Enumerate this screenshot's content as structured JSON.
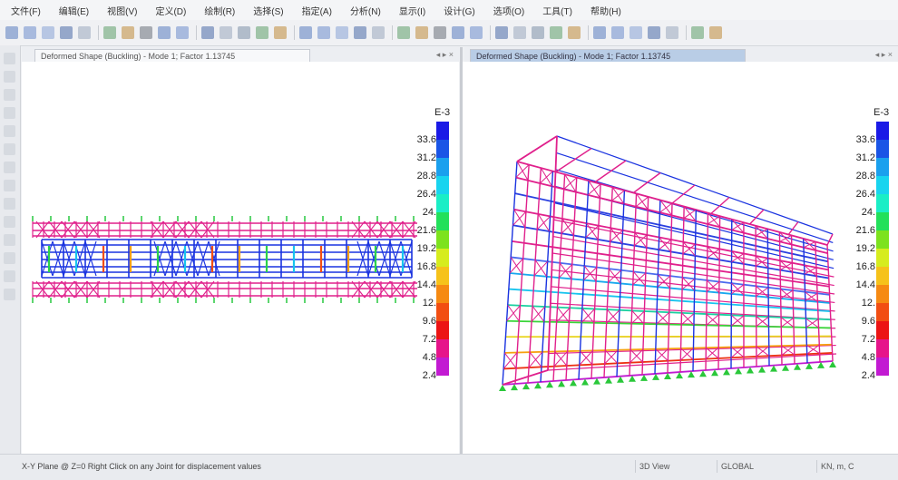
{
  "menu": [
    "文件(F)",
    "编辑(E)",
    "视图(V)",
    "定义(D)",
    "绘制(R)",
    "选择(S)",
    "指定(A)",
    "分析(N)",
    "显示(I)",
    "设计(G)",
    "选项(O)",
    "工具(T)",
    "帮助(H)"
  ],
  "left_view": {
    "tab_title": "Deformed Shape (Buckling) - Mode 1; Factor 1.13745",
    "tab_controls": "◂ ▸ ×",
    "legend": {
      "exponent": "E-3",
      "labels": [
        "33.6",
        "31.2",
        "28.8",
        "26.4",
        "24.",
        "21.6",
        "19.2",
        "16.8",
        "14.4",
        "12.",
        "9.6",
        "7.2",
        "4.8",
        "2.4"
      ]
    }
  },
  "right_view": {
    "tab_title": "Deformed Shape (Buckling) - Mode 1; Factor 1.13745",
    "tab_controls": "◂ ▸ ×",
    "legend": {
      "exponent": "E-3",
      "labels": [
        "33.6",
        "31.2",
        "28.8",
        "26.4",
        "24.",
        "21.6",
        "19.2",
        "16.8",
        "14.4",
        "12.",
        "9.6",
        "7.2",
        "4.8",
        "2.4"
      ]
    }
  },
  "legend_colors": [
    "#1a1ae6",
    "#1a55e6",
    "#1aa0ee",
    "#18d4ef",
    "#1aeec6",
    "#22e05a",
    "#7de21e",
    "#d6ec1e",
    "#f6c21a",
    "#f68a12",
    "#f24e12",
    "#ec1414",
    "#e6148a",
    "#c21ad2"
  ],
  "status": {
    "text": "X-Y Plane @ Z=0  Right Click on any Joint for displacement values",
    "fields": [
      "3D View",
      "GLOBAL",
      "KN, m, C"
    ]
  }
}
